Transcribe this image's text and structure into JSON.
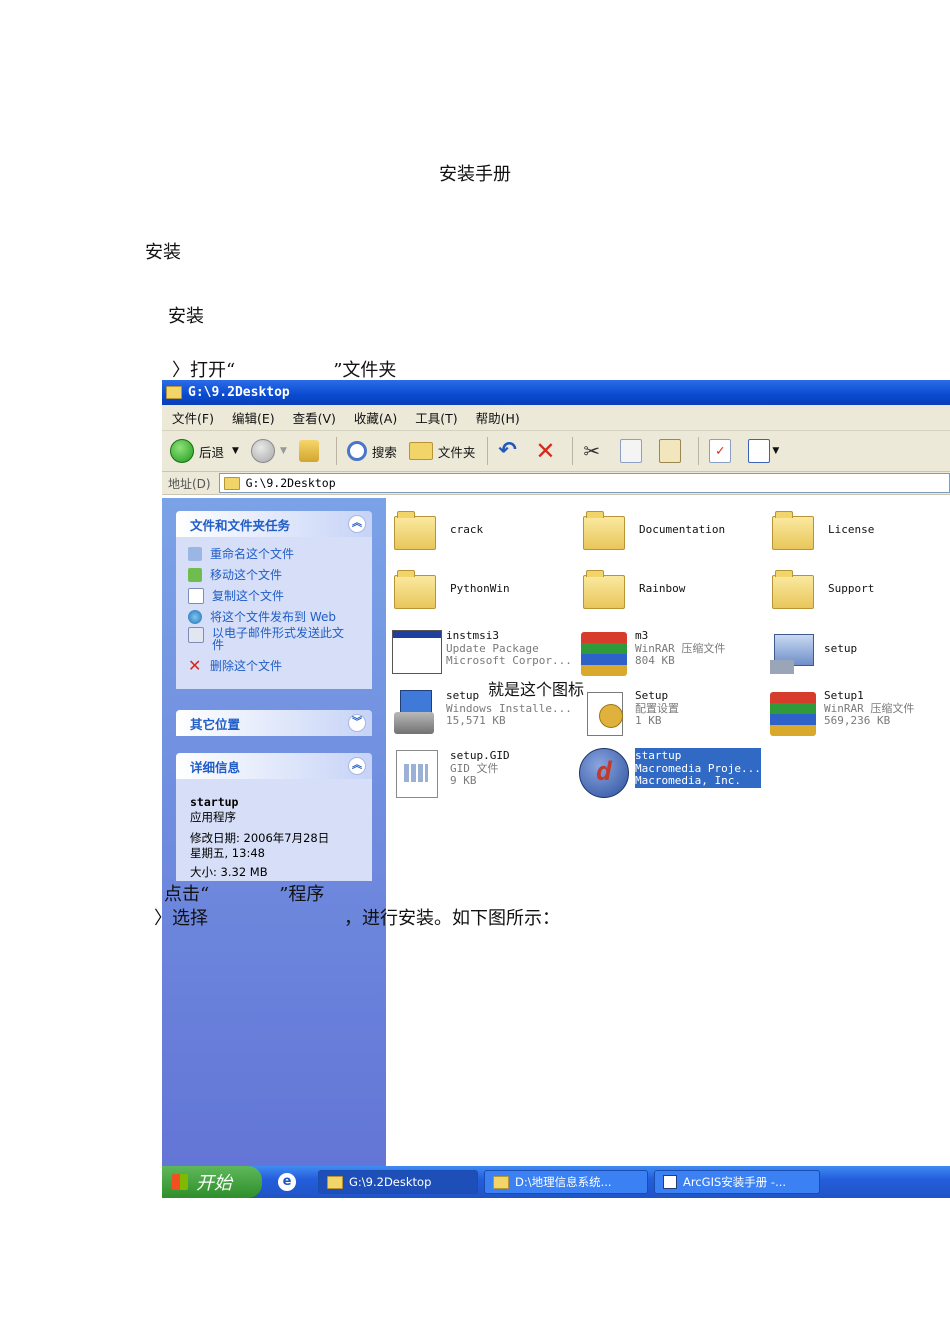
{
  "doc": {
    "title": "安装手册",
    "heading1": "安装",
    "heading2": "安装",
    "step1_prefix": "〉打开“",
    "step1_suffix": "”文件夹",
    "click_prefix": "点击“",
    "click_suffix": "”程序",
    "select_prefix": "〉选择",
    "select_suffix": "，进行安装。如下图所示：",
    "icon_note": "就是这个图标"
  },
  "window": {
    "title": "G:\\9.2Desktop",
    "menu": [
      "文件(F)",
      "编辑(E)",
      "查看(V)",
      "收藏(A)",
      "工具(T)",
      "帮助(H)"
    ],
    "toolbar": {
      "back": "后退",
      "search": "搜索",
      "folders": "文件夹"
    },
    "address_label": "地址(D)",
    "address_value": "G:\\9.2Desktop",
    "tasks_panel": {
      "title": "文件和文件夹任务",
      "items": [
        "重命名这个文件",
        "移动这个文件",
        "复制这个文件",
        "将这个文件发布到 Web",
        "以电子邮件形式发送此文件",
        "删除这个文件"
      ]
    },
    "other_places": {
      "title": "其它位置"
    },
    "details_panel": {
      "title": "详细信息",
      "name": "startup",
      "type": "应用程序",
      "modified": "修改日期: 2006年7月28日",
      "weekday": "星期五, 13:48",
      "size": "大小: 3.32 MB"
    },
    "files": [
      {
        "name": "crack",
        "kind": "folder"
      },
      {
        "name": "Documentation",
        "kind": "folder"
      },
      {
        "name": "License",
        "kind": "folder"
      },
      {
        "name": "PythonWin",
        "kind": "folder"
      },
      {
        "name": "Rainbow",
        "kind": "folder"
      },
      {
        "name": "Support",
        "kind": "folder"
      },
      {
        "name": "instmsi3",
        "line2": "Update Package",
        "line3": "Microsoft Corpor...",
        "kind": "window"
      },
      {
        "name": "m3",
        "line2": "WinRAR 压缩文件",
        "line3": "804 KB",
        "kind": "rar"
      },
      {
        "name": "setup",
        "kind": "setup-pc"
      },
      {
        "name": "setup",
        "line2": "Windows Installe...",
        "line3": "15,571 KB",
        "kind": "msi"
      },
      {
        "name": "Setup",
        "line2": "配置设置",
        "line3": "1 KB",
        "kind": "ini"
      },
      {
        "name": "Setup1",
        "line2": "WinRAR 压缩文件",
        "line3": "569,236 KB",
        "kind": "rar"
      },
      {
        "name": "setup.GID",
        "line2": "GID 文件",
        "line3": "9 KB",
        "kind": "gid"
      },
      {
        "name": "startup",
        "line2": "Macromedia Proje...",
        "line3": "Macromedia, Inc.",
        "kind": "macromedia"
      }
    ],
    "taskbar": {
      "start": "开始",
      "buttons": [
        "G:\\9.2Desktop",
        "D:\\地理信息系统...",
        "ArcGIS安装手册 -..."
      ]
    }
  },
  "colors": {
    "xp_blue": "#0a4ad0",
    "task_blue": "#215dc6",
    "selection": "#316ac5",
    "start_green": "#2f8f2c"
  }
}
